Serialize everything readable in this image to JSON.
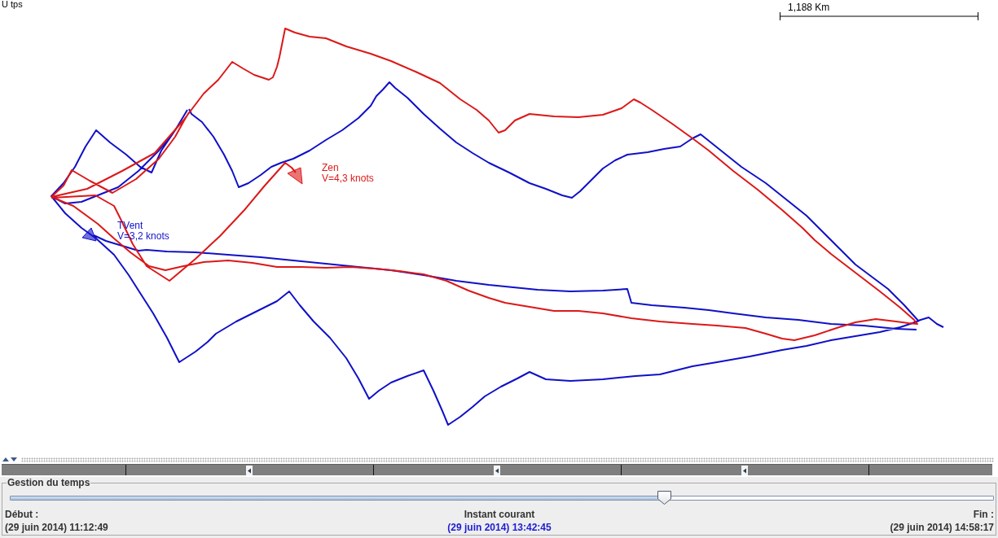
{
  "map": {
    "corner_label": "U tps",
    "scale_label": "1,188 Km",
    "boats": [
      {
        "name": "TVent",
        "speed": "V=3,2 knots",
        "color": "#1010c8"
      },
      {
        "name": "Zen",
        "speed": "V=4,3 knots",
        "color": "#dc1818"
      }
    ]
  },
  "time_panel": {
    "title": "Gestion du temps",
    "slider": {
      "level": 0.665
    },
    "start": {
      "label": "Début :",
      "value": "(29 juin 2014) 11:12:49"
    },
    "current": {
      "label": "Instant courant",
      "value": "(29 juin 2014) 13:42:45"
    },
    "end": {
      "label": "Fin :",
      "value": "(29 juin 2014) 14:58:17"
    }
  }
}
